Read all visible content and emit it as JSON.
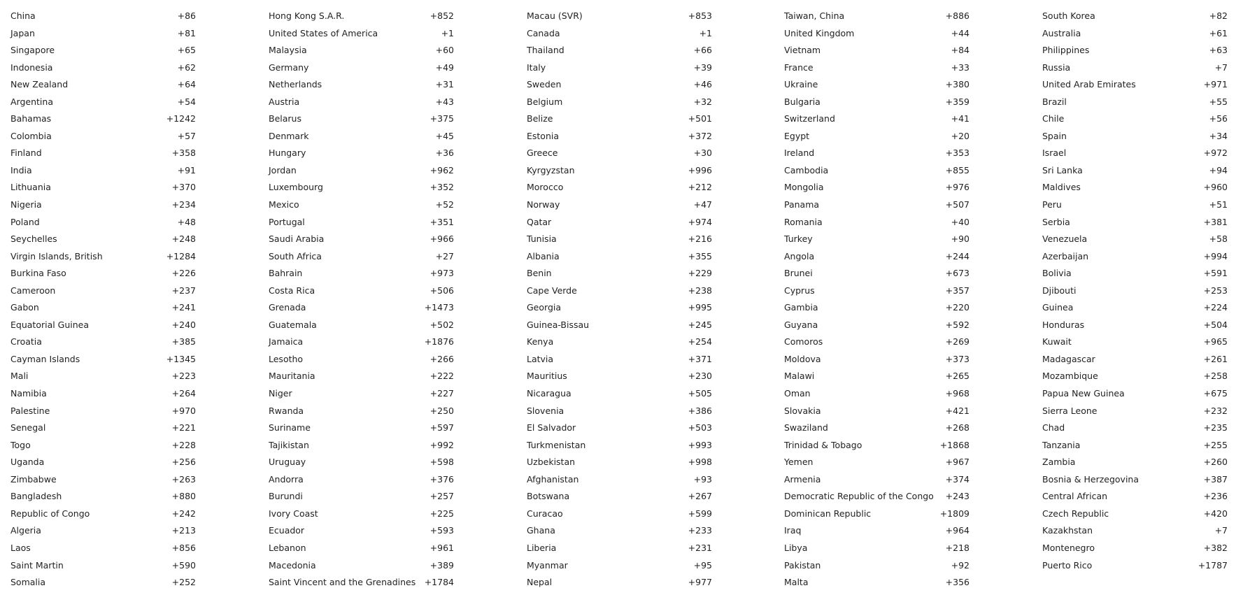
{
  "columns": [
    [
      {
        "name": "China",
        "code": "+86"
      },
      {
        "name": "Japan",
        "code": "+81"
      },
      {
        "name": "Singapore",
        "code": "+65"
      },
      {
        "name": "Indonesia",
        "code": "+62"
      },
      {
        "name": "New Zealand",
        "code": "+64"
      },
      {
        "name": "Argentina",
        "code": "+54"
      },
      {
        "name": "Bahamas",
        "code": "+1242"
      },
      {
        "name": "Colombia",
        "code": "+57"
      },
      {
        "name": "Finland",
        "code": "+358"
      },
      {
        "name": "India",
        "code": "+91"
      },
      {
        "name": "Lithuania",
        "code": "+370"
      },
      {
        "name": "Nigeria",
        "code": "+234"
      },
      {
        "name": "Poland",
        "code": "+48"
      },
      {
        "name": "Seychelles",
        "code": "+248"
      },
      {
        "name": "Virgin Islands, British",
        "code": "+1284"
      },
      {
        "name": "Burkina Faso",
        "code": "+226"
      },
      {
        "name": "Cameroon",
        "code": "+237"
      },
      {
        "name": "Gabon",
        "code": "+241"
      },
      {
        "name": "Equatorial Guinea",
        "code": "+240"
      },
      {
        "name": "Croatia",
        "code": "+385"
      },
      {
        "name": "Cayman Islands",
        "code": "+1345"
      },
      {
        "name": "Mali",
        "code": "+223"
      },
      {
        "name": "Namibia",
        "code": "+264"
      },
      {
        "name": "Palestine",
        "code": "+970"
      },
      {
        "name": "Senegal",
        "code": "+221"
      },
      {
        "name": "Togo",
        "code": "+228"
      },
      {
        "name": "Uganda",
        "code": "+256"
      },
      {
        "name": "Zimbabwe",
        "code": "+263"
      },
      {
        "name": "Bangladesh",
        "code": "+880"
      },
      {
        "name": "Republic of Congo",
        "code": "+242"
      },
      {
        "name": "Algeria",
        "code": "+213"
      },
      {
        "name": "Laos",
        "code": "+856"
      },
      {
        "name": "Saint Martin",
        "code": "+590"
      },
      {
        "name": "Somalia",
        "code": "+252"
      }
    ],
    [
      {
        "name": "Hong Kong S.A.R.",
        "code": "+852"
      },
      {
        "name": "United States of America",
        "code": "+1"
      },
      {
        "name": "Malaysia",
        "code": "+60"
      },
      {
        "name": "Germany",
        "code": "+49"
      },
      {
        "name": "Netherlands",
        "code": "+31"
      },
      {
        "name": "Austria",
        "code": "+43"
      },
      {
        "name": "Belarus",
        "code": "+375"
      },
      {
        "name": "Denmark",
        "code": "+45"
      },
      {
        "name": "Hungary",
        "code": "+36"
      },
      {
        "name": "Jordan",
        "code": "+962"
      },
      {
        "name": "Luxembourg",
        "code": "+352"
      },
      {
        "name": "Mexico",
        "code": "+52"
      },
      {
        "name": "Portugal",
        "code": "+351"
      },
      {
        "name": "Saudi Arabia",
        "code": "+966"
      },
      {
        "name": "South Africa",
        "code": "+27"
      },
      {
        "name": "Bahrain",
        "code": "+973"
      },
      {
        "name": "Costa Rica",
        "code": "+506"
      },
      {
        "name": "Grenada",
        "code": "+1473"
      },
      {
        "name": "Guatemala",
        "code": "+502"
      },
      {
        "name": "Jamaica",
        "code": "+1876"
      },
      {
        "name": "Lesotho",
        "code": "+266"
      },
      {
        "name": "Mauritania",
        "code": "+222"
      },
      {
        "name": "Niger",
        "code": "+227"
      },
      {
        "name": "Rwanda",
        "code": "+250"
      },
      {
        "name": "Suriname",
        "code": "+597"
      },
      {
        "name": "Tajikistan",
        "code": "+992"
      },
      {
        "name": "Uruguay",
        "code": "+598"
      },
      {
        "name": "Andorra",
        "code": "+376"
      },
      {
        "name": "Burundi",
        "code": "+257"
      },
      {
        "name": "Ivory Coast",
        "code": "+225"
      },
      {
        "name": "Ecuador",
        "code": "+593"
      },
      {
        "name": "Lebanon",
        "code": "+961"
      },
      {
        "name": "Macedonia",
        "code": "+389"
      },
      {
        "name": "Saint Vincent and the Grenadines",
        "code": "+1784"
      }
    ],
    [
      {
        "name": "Macau (SVR)",
        "code": "+853"
      },
      {
        "name": "Canada",
        "code": "+1"
      },
      {
        "name": "Thailand",
        "code": "+66"
      },
      {
        "name": "Italy",
        "code": "+39"
      },
      {
        "name": "Sweden",
        "code": "+46"
      },
      {
        "name": "Belgium",
        "code": "+32"
      },
      {
        "name": "Belize",
        "code": "+501"
      },
      {
        "name": "Estonia",
        "code": "+372"
      },
      {
        "name": "Greece",
        "code": "+30"
      },
      {
        "name": "Kyrgyzstan",
        "code": "+996"
      },
      {
        "name": "Morocco",
        "code": "+212"
      },
      {
        "name": "Norway",
        "code": "+47"
      },
      {
        "name": "Qatar",
        "code": "+974"
      },
      {
        "name": "Tunisia",
        "code": "+216"
      },
      {
        "name": "Albania",
        "code": "+355"
      },
      {
        "name": "Benin",
        "code": "+229"
      },
      {
        "name": "Cape Verde",
        "code": "+238"
      },
      {
        "name": "Georgia",
        "code": "+995"
      },
      {
        "name": "Guinea-Bissau",
        "code": "+245"
      },
      {
        "name": "Kenya",
        "code": "+254"
      },
      {
        "name": "Latvia",
        "code": "+371"
      },
      {
        "name": "Mauritius",
        "code": "+230"
      },
      {
        "name": "Nicaragua",
        "code": "+505"
      },
      {
        "name": "Slovenia",
        "code": "+386"
      },
      {
        "name": "El Salvador",
        "code": "+503"
      },
      {
        "name": "Turkmenistan",
        "code": "+993"
      },
      {
        "name": "Uzbekistan",
        "code": "+998"
      },
      {
        "name": "Afghanistan",
        "code": "+93"
      },
      {
        "name": "Botswana",
        "code": "+267"
      },
      {
        "name": "Curacao",
        "code": "+599"
      },
      {
        "name": "Ghana",
        "code": "+233"
      },
      {
        "name": "Liberia",
        "code": "+231"
      },
      {
        "name": "Myanmar",
        "code": "+95"
      },
      {
        "name": "Nepal",
        "code": "+977"
      }
    ],
    [
      {
        "name": "Taiwan, China",
        "code": "+886"
      },
      {
        "name": "United Kingdom",
        "code": "+44"
      },
      {
        "name": "Vietnam",
        "code": "+84"
      },
      {
        "name": "France",
        "code": "+33"
      },
      {
        "name": "Ukraine",
        "code": "+380"
      },
      {
        "name": "Bulgaria",
        "code": "+359"
      },
      {
        "name": "Switzerland",
        "code": "+41"
      },
      {
        "name": "Egypt",
        "code": "+20"
      },
      {
        "name": "Ireland",
        "code": "+353"
      },
      {
        "name": "Cambodia",
        "code": "+855"
      },
      {
        "name": "Mongolia",
        "code": "+976"
      },
      {
        "name": "Panama",
        "code": "+507"
      },
      {
        "name": "Romania",
        "code": "+40"
      },
      {
        "name": "Turkey",
        "code": "+90"
      },
      {
        "name": "Angola",
        "code": "+244"
      },
      {
        "name": "Brunei",
        "code": "+673"
      },
      {
        "name": "Cyprus",
        "code": "+357"
      },
      {
        "name": "Gambia",
        "code": "+220"
      },
      {
        "name": "Guyana",
        "code": "+592"
      },
      {
        "name": "Comoros",
        "code": "+269"
      },
      {
        "name": "Moldova",
        "code": "+373"
      },
      {
        "name": "Malawi",
        "code": "+265"
      },
      {
        "name": "Oman",
        "code": "+968"
      },
      {
        "name": "Slovakia",
        "code": "+421"
      },
      {
        "name": "Swaziland",
        "code": "+268"
      },
      {
        "name": "Trinidad & Tobago",
        "code": "+1868"
      },
      {
        "name": "Yemen",
        "code": "+967"
      },
      {
        "name": "Armenia",
        "code": "+374"
      },
      {
        "name": "Democratic Republic of the Congo",
        "code": "+243"
      },
      {
        "name": "Dominican Republic",
        "code": "+1809"
      },
      {
        "name": "Iraq",
        "code": "+964"
      },
      {
        "name": "Libya",
        "code": "+218"
      },
      {
        "name": "Pakistan",
        "code": "+92"
      },
      {
        "name": "Malta",
        "code": "+356"
      }
    ],
    [
      {
        "name": "South Korea",
        "code": "+82"
      },
      {
        "name": "Australia",
        "code": "+61"
      },
      {
        "name": "Philippines",
        "code": "+63"
      },
      {
        "name": "Russia",
        "code": "+7"
      },
      {
        "name": "United Arab Emirates",
        "code": "+971"
      },
      {
        "name": "Brazil",
        "code": "+55"
      },
      {
        "name": "Chile",
        "code": "+56"
      },
      {
        "name": "Spain",
        "code": "+34"
      },
      {
        "name": "Israel",
        "code": "+972"
      },
      {
        "name": "Sri Lanka",
        "code": "+94"
      },
      {
        "name": "Maldives",
        "code": "+960"
      },
      {
        "name": "Peru",
        "code": "+51"
      },
      {
        "name": "Serbia",
        "code": "+381"
      },
      {
        "name": "Venezuela",
        "code": "+58"
      },
      {
        "name": "Azerbaijan",
        "code": "+994"
      },
      {
        "name": "Bolivia",
        "code": "+591"
      },
      {
        "name": "Djibouti",
        "code": "+253"
      },
      {
        "name": "Guinea",
        "code": "+224"
      },
      {
        "name": "Honduras",
        "code": "+504"
      },
      {
        "name": "Kuwait",
        "code": "+965"
      },
      {
        "name": "Madagascar",
        "code": "+261"
      },
      {
        "name": "Mozambique",
        "code": "+258"
      },
      {
        "name": "Papua New Guinea",
        "code": "+675"
      },
      {
        "name": "Sierra Leone",
        "code": "+232"
      },
      {
        "name": "Chad",
        "code": "+235"
      },
      {
        "name": "Tanzania",
        "code": "+255"
      },
      {
        "name": "Zambia",
        "code": "+260"
      },
      {
        "name": "Bosnia & Herzegovina",
        "code": "+387"
      },
      {
        "name": "Central African",
        "code": "+236"
      },
      {
        "name": "Czech Republic",
        "code": "+420"
      },
      {
        "name": "Kazakhstan",
        "code": "+7"
      },
      {
        "name": "Montenegro",
        "code": "+382"
      },
      {
        "name": "Puerto Rico",
        "code": "+1787"
      }
    ]
  ]
}
